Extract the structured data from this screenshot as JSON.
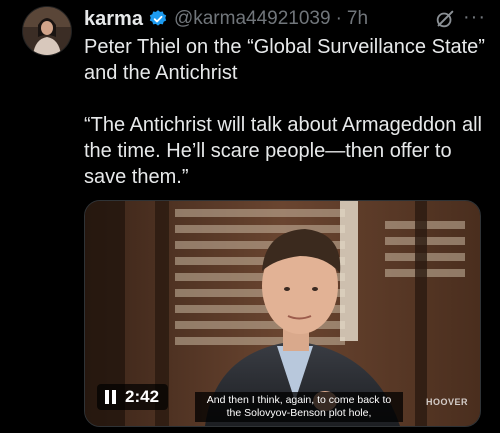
{
  "author": {
    "display_name": "karma",
    "handle": "@karma44921039",
    "separator": "·",
    "time": "7h",
    "verified_icon": "verified-badge-icon",
    "avatar_icon": "avatar-photo"
  },
  "actions": {
    "grok_icon": "grok-icon",
    "more_label": "···"
  },
  "tweet": {
    "line1": "Peter Thiel on the “Global Surveillance State” and the Antichrist",
    "line2": "“The Antichrist will talk about Armageddon all the time. He’ll scare people—then offer to save them.”"
  },
  "video": {
    "duration": "2:42",
    "caption": "And then I think, again, to come back to the Solovyov-Benson plot hole,",
    "watermark": "HOOVER"
  },
  "colors": {
    "background": "#000000",
    "text": "#e7e9ea",
    "muted": "#71767b",
    "verified": "#1d9bf0"
  }
}
